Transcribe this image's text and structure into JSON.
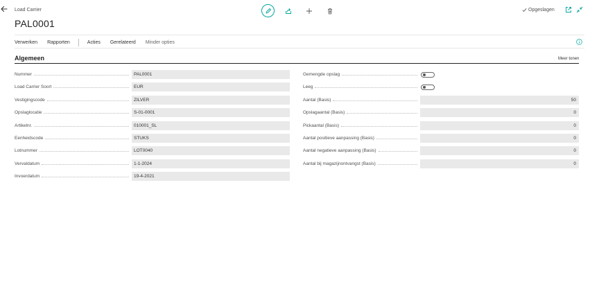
{
  "header": {
    "breadcrumb": "Load Carrier",
    "title": "PAL0001",
    "saved_label": "Opgeslagen"
  },
  "actions": {
    "verwerken": "Verwerken",
    "rapporten": "Rapporten",
    "acties": "Acties",
    "gerelateerd": "Gerelateerd",
    "minder": "Minder opties"
  },
  "section": {
    "title": "Algemeen",
    "more": "Meer tonen"
  },
  "left_fields": [
    {
      "label": "Nummer",
      "value": "PAL0001"
    },
    {
      "label": "Load Carrier Soort",
      "value": "EUR"
    },
    {
      "label": "Vestigingscode",
      "value": "ZILVER"
    },
    {
      "label": "Opslaglocatie",
      "value": "S-01-0001"
    },
    {
      "label": "Artikelnr.",
      "value": "010001_SL"
    },
    {
      "label": "Eenheidscode",
      "value": "STUKS"
    },
    {
      "label": "Lotnummer",
      "value": "LOT0040"
    },
    {
      "label": "Vervaldatum",
      "value": "1-1-2024"
    },
    {
      "label": "Invoerdatum",
      "value": "19-4-2021"
    }
  ],
  "right_toggles": [
    {
      "label": "Gemengde opslag",
      "on": false
    },
    {
      "label": "Leeg",
      "on": false
    }
  ],
  "right_fields": [
    {
      "label": "Aantal (Basis)",
      "value": "50"
    },
    {
      "label": "Opslagaantal (Basis)",
      "value": "0"
    },
    {
      "label": "Pickaantal (Basis)",
      "value": "0"
    },
    {
      "label": "Aantal positieve aanpassing (Basis)",
      "value": "0"
    },
    {
      "label": "Aantal negatieve aanpassing (Basis)",
      "value": "0"
    },
    {
      "label": "Aantal bij magazijnontvangst (Basis)",
      "value": "0"
    }
  ],
  "colors": {
    "accent": "#00a59b",
    "field_bg": "#e9e9e9"
  }
}
